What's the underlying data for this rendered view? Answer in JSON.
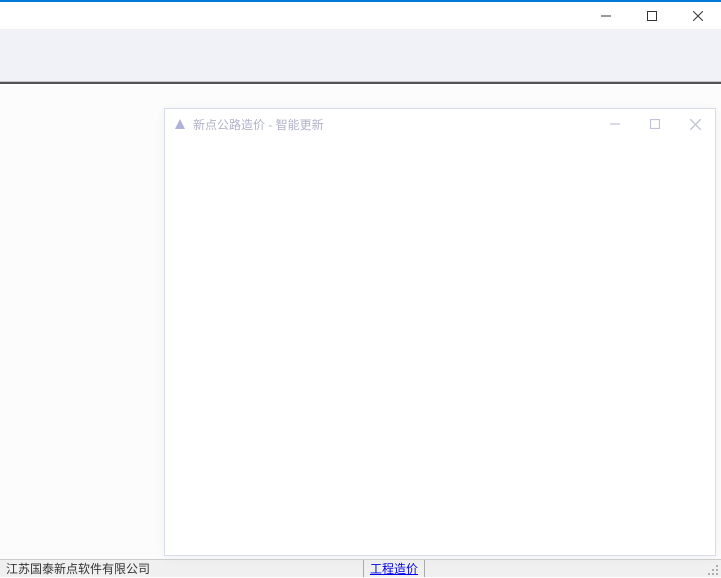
{
  "dialog": {
    "title": "新点公路造价 - 智能更新"
  },
  "statusbar": {
    "company": "江苏国泰新点软件有限公司",
    "link": "工程造价"
  }
}
